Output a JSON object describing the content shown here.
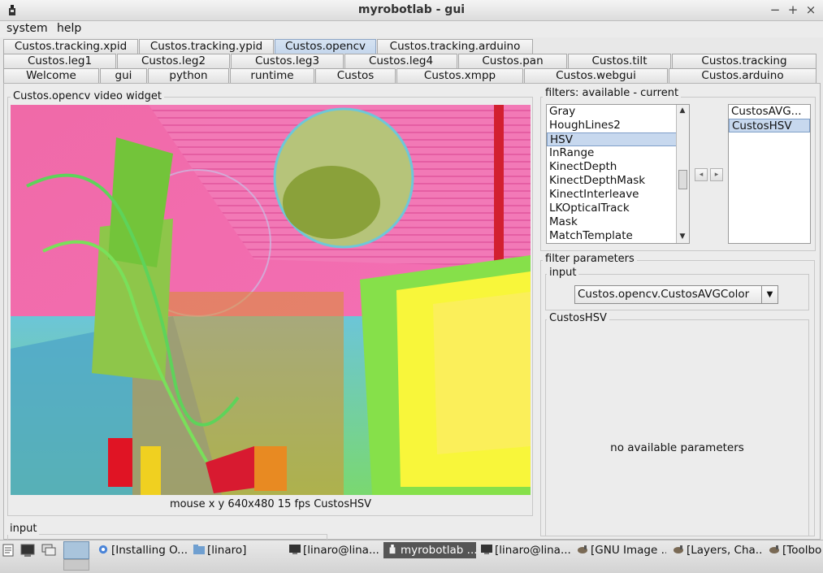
{
  "window": {
    "title": "myrobotlab - gui",
    "controls": [
      "−",
      "+",
      "×"
    ]
  },
  "menu": [
    "system",
    "help"
  ],
  "tabs_row1": [
    {
      "label": "Custos.tracking.xpid",
      "selected": false
    },
    {
      "label": "Custos.tracking.ypid",
      "selected": false
    },
    {
      "label": "Custos.opencv",
      "selected": true
    },
    {
      "label": "Custos.tracking.arduino",
      "selected": false
    }
  ],
  "tabs_row2": [
    {
      "label": "Custos.leg1"
    },
    {
      "label": "Custos.leg2"
    },
    {
      "label": "Custos.leg3"
    },
    {
      "label": "Custos.leg4"
    },
    {
      "label": "Custos.pan"
    },
    {
      "label": "Custos.tilt"
    },
    {
      "label": "Custos.tracking"
    }
  ],
  "tabs_row3": [
    {
      "label": "Welcome"
    },
    {
      "label": "gui"
    },
    {
      "label": "python"
    },
    {
      "label": "runtime"
    },
    {
      "label": "Custos"
    },
    {
      "label": "Custos.xmpp"
    },
    {
      "label": "Custos.webgui"
    },
    {
      "label": "Custos.arduino"
    }
  ],
  "video_panel": {
    "label": "Custos.opencv  video widget",
    "status": "mouse x y  640x480  15 fps  CustosHSV"
  },
  "input_label": "input",
  "filters": {
    "label": "filters: available - current",
    "available": [
      "Gray",
      "HoughLines2",
      "HSV",
      "InRange",
      "KinectDepth",
      "KinectDepthMask",
      "KinectInterleave",
      "LKOpticalTrack",
      "Mask",
      "MatchTemplate"
    ],
    "available_selected": "HSV",
    "current": [
      "CustosAVG...",
      "CustosHSV"
    ],
    "current_selected": "CustosHSV",
    "add_arrow": "◂",
    "remove_arrow": "▸"
  },
  "filter_parameters": {
    "label": "filter parameters",
    "input_label": "input",
    "input_value": "Custos.opencv.CustosAVGColor",
    "section_label": "CustosHSV",
    "message": "no available parameters"
  },
  "taskbar": {
    "items": [
      {
        "label": "[Installing O..."
      },
      {
        "label": "[linaro]"
      },
      {
        "label": "[linaro@lina..."
      },
      {
        "label": "myrobotlab ...",
        "active": true
      },
      {
        "label": "[linaro@lina..."
      },
      {
        "label": "[GNU Image ..."
      },
      {
        "label": "[Layers, Cha..."
      },
      {
        "label": "[Toolbo"
      }
    ]
  }
}
